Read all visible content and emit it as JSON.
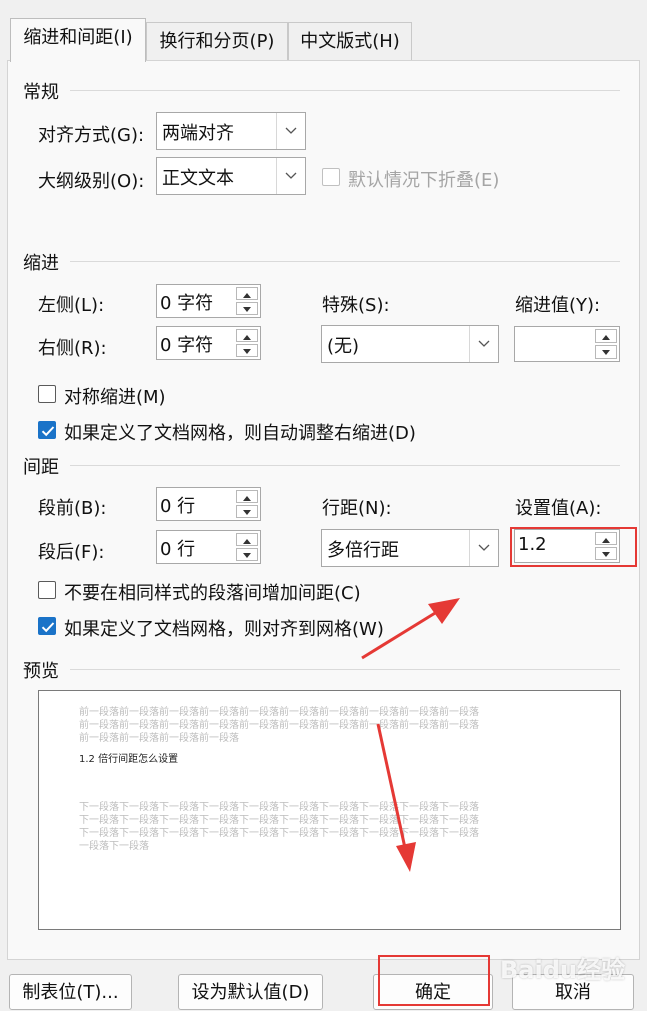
{
  "tabs": [
    {
      "label": "缩进和间距(I)",
      "active": true
    },
    {
      "label": "换行和分页(P)",
      "active": false
    },
    {
      "label": "中文版式(H)",
      "active": false
    }
  ],
  "general": {
    "title": "常规",
    "align_label": "对齐方式(G):",
    "align_value": "两端对齐",
    "outline_label": "大纲级别(O):",
    "outline_value": "正文文本",
    "collapse_label": "默认情况下折叠(E)"
  },
  "indent": {
    "title": "缩进",
    "left_label": "左侧(L):",
    "left_value": "0 字符",
    "right_label": "右侧(R):",
    "right_value": "0 字符",
    "special_label": "特殊(S):",
    "special_value": "(无)",
    "by_label": "缩进值(Y):",
    "by_value": "",
    "mirror_label": "对称缩进(M)",
    "grid_label": "如果定义了文档网格，则自动调整右缩进(D)"
  },
  "spacing": {
    "title": "间距",
    "before_label": "段前(B):",
    "before_value": "0 行",
    "after_label": "段后(F):",
    "after_value": "0 行",
    "line_label": "行距(N):",
    "line_value": "多倍行距",
    "at_label": "设置值(A):",
    "at_value": "1.2",
    "no_space_label": "不要在相同样式的段落间增加间距(C)",
    "snap_label": "如果定义了文档网格，则对齐到网格(W)"
  },
  "preview": {
    "title": "预览",
    "prev_lines": [
      "前一段落前一段落前一段落前一段落前一段落前一段落前一段落前一段落前一段落前一段落",
      "前一段落前一段落前一段落前一段落前一段落前一段落前一段落前一段落前一段落前一段落",
      "前一段落前一段落前一段落前一段落"
    ],
    "sample": "1.2 倍行间距怎么设置",
    "next_lines": [
      "下一段落下一段落下一段落下一段落下一段落下一段落下一段落下一段落下一段落下一段落",
      "下一段落下一段落下一段落下一段落下一段落下一段落下一段落下一段落下一段落下一段落",
      "下一段落下一段落下一段落下一段落下一段落下一段落下一段落下一段落下一段落下一段落",
      "一段落下一段落"
    ]
  },
  "buttons": {
    "tabs": "制表位(T)...",
    "default": "设为默认值(D)",
    "ok": "确定",
    "cancel": "取消"
  },
  "watermark": "Baidu经验"
}
